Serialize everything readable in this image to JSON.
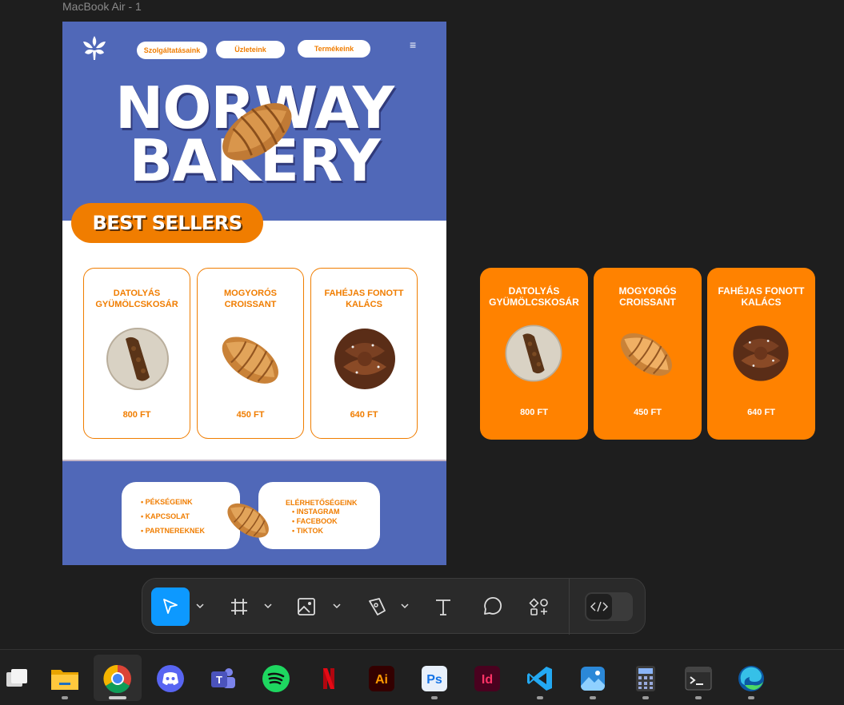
{
  "frame_label": "MacBook Air - 1",
  "nav": [
    "Szolgáltatásaink",
    "Üzleteink",
    "Termékeink"
  ],
  "hero_title": [
    "NORWAY",
    "BAKERY"
  ],
  "best_sellers": "BEST SELLERS",
  "products": [
    {
      "name": "DATOLYÁS GYÜMÖLCSKOSÁR",
      "price": "800 FT"
    },
    {
      "name": "MOGYORÓS CROISSANT",
      "price": "450 FT"
    },
    {
      "name": "FAHÉJAS FONOTT KALÁCS",
      "price": "640 FT"
    }
  ],
  "footer_left": [
    "PÉKSÉGEINK",
    "KAPCSOLAT",
    "PARTNEREKNEK"
  ],
  "footer_right_title": "ELÉRHETŐSÉGEINK",
  "footer_right": [
    "INSTAGRAM",
    "FACEBOOK",
    "TIKTOK"
  ],
  "toolbar_tools": [
    "move-tool",
    "frame-tool",
    "image-tool",
    "pen-tool",
    "text-tool",
    "comment-tool",
    "components-tool",
    "dev-mode-toggle"
  ],
  "taskbar_apps": [
    "task-view",
    "file-explorer",
    "chrome",
    "discord",
    "teams",
    "spotify",
    "netflix",
    "illustrator",
    "photoshop",
    "indesign",
    "vscode",
    "photos",
    "calculator",
    "terminal",
    "edge"
  ],
  "taskbar_labels": {
    "illustrator": "Ai",
    "photoshop": "Ps",
    "indesign": "Id",
    "teams": "T"
  },
  "colors": {
    "accent": "#f07d00",
    "hero_blue": "#5068b8",
    "figma_blue": "#0d99ff"
  }
}
